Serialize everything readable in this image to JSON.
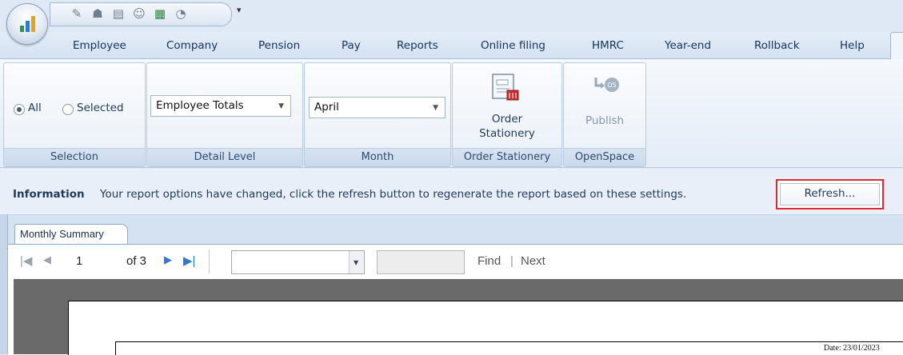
{
  "menu": [
    "Employee",
    "Company",
    "Pension",
    "Pay",
    "Reports",
    "Online filing",
    "HMRC",
    "Year-end",
    "Rollback",
    "Help"
  ],
  "ribbon": {
    "selection": {
      "all_label": "All",
      "selected_label": "Selected",
      "group_label": "Selection",
      "selected_option": "All"
    },
    "detail_level": {
      "value": "Employee Totals",
      "group_label": "Detail Level"
    },
    "month": {
      "value": "April",
      "group_label": "Month"
    },
    "order_stationery": {
      "button_label_line1": "Order",
      "button_label_line2": "Stationery",
      "group_label": "Order Stationery"
    },
    "openspace": {
      "button_label": "Publish",
      "group_label": "OpenSpace"
    }
  },
  "info": {
    "title": "Information",
    "message": "Your report options have changed, click the refresh button to regenerate the report based on these settings.",
    "refresh_label": "Refresh..."
  },
  "report": {
    "tab_label": "Monthly Summary",
    "page_number": "1",
    "page_of": "of 3",
    "find_label": "Find",
    "separator": "|",
    "next_label": "Next",
    "date_text": "Date: 23/01/2023"
  },
  "colors": {
    "accent": "#1f3a5a",
    "highlight_border": "#e0292c",
    "viewer_bg": "#6a6a6a"
  }
}
